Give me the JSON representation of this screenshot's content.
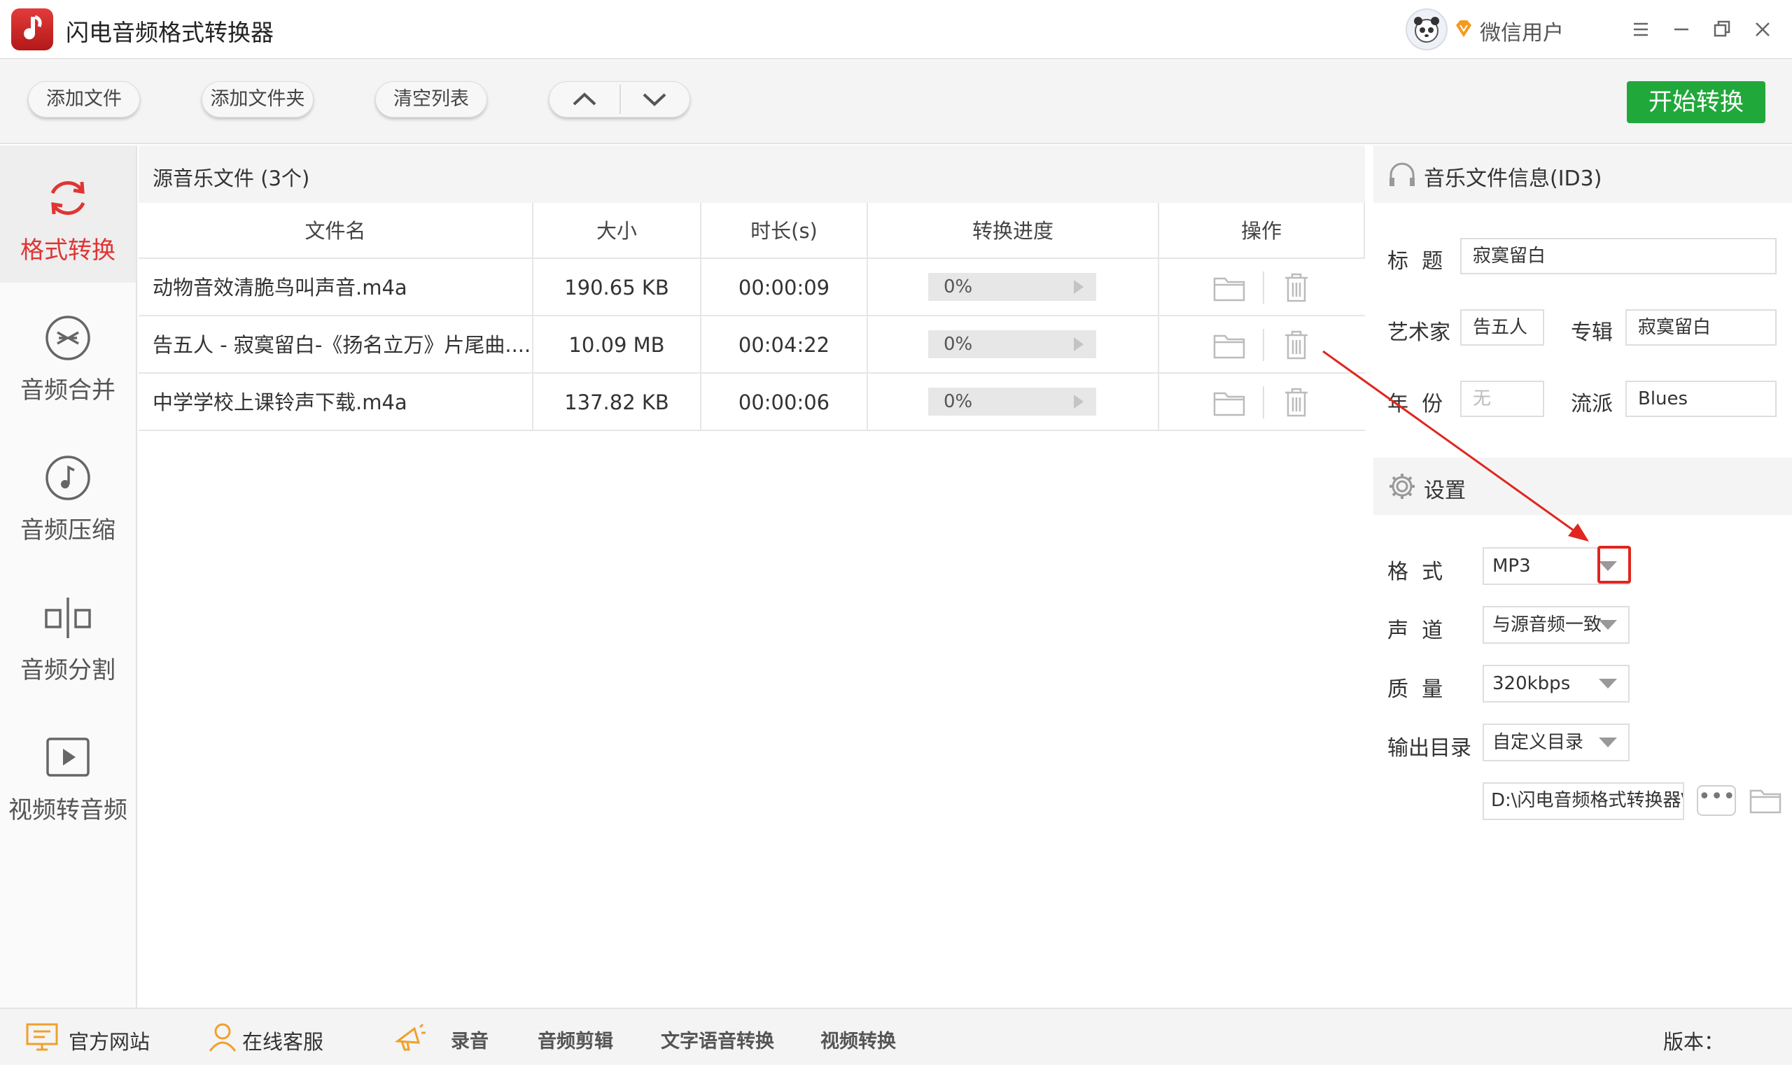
{
  "app": {
    "title": "闪电音频格式转换器",
    "user_name": "微信用户"
  },
  "toolbar": {
    "add_file": "添加文件",
    "add_folder": "添加文件夹",
    "clear_list": "清空列表",
    "start": "开始转换"
  },
  "sidebar": {
    "items": [
      {
        "label": "格式转换",
        "icon": "refresh-icon",
        "active": true
      },
      {
        "label": "音频合并",
        "icon": "merge-icon",
        "active": false
      },
      {
        "label": "音频压缩",
        "icon": "music-note-icon",
        "active": false
      },
      {
        "label": "音频分割",
        "icon": "split-icon",
        "active": false
      },
      {
        "label": "视频转音频",
        "icon": "play-icon",
        "active": false
      }
    ]
  },
  "file_list": {
    "title": "源音乐文件 (3个)",
    "columns": [
      "文件名",
      "大小",
      "时长(s)",
      "转换进度",
      "操作"
    ],
    "rows": [
      {
        "name": "动物音效清脆鸟叫声音.m4a",
        "size": "190.65 KB",
        "duration": "00:00:09",
        "progress": "0%"
      },
      {
        "name": "告五人 - 寂寞留白-《扬名立万》片尾曲....",
        "size": "10.09 MB",
        "duration": "00:04:22",
        "progress": "0%"
      },
      {
        "name": "中学学校上课铃声下载.m4a",
        "size": "137.82 KB",
        "duration": "00:00:06",
        "progress": "0%"
      }
    ]
  },
  "id3": {
    "header": "音乐文件信息(ID3)",
    "title_label": "标  题",
    "title_value": "寂寞留白",
    "artist_label": "艺术家",
    "artist_value": "告五人",
    "album_label": "专辑",
    "album_value": "寂寞留白",
    "year_label": "年  份",
    "year_placeholder": "无",
    "genre_label": "流派",
    "genre_value": "Blues"
  },
  "settings": {
    "header": "设置",
    "format_label": "格  式",
    "format_value": "MP3",
    "channel_label": "声  道",
    "channel_value": "与源音频一致",
    "quality_label": "质  量",
    "quality_value": "320kbps",
    "output_label": "输出目录",
    "output_value": "自定义目录",
    "output_path": "D:\\闪电音频格式转换器\\",
    "more": "•••"
  },
  "footer": {
    "website": "官方网站",
    "service": "在线客服",
    "record": "录音",
    "edit": "音频剪辑",
    "tts": "文字语音转换",
    "video": "视频转换",
    "version_label": "版本："
  },
  "colors": {
    "accent_red": "#e03535",
    "start_green": "#21a83b",
    "annotation_red": "#e0261e"
  }
}
